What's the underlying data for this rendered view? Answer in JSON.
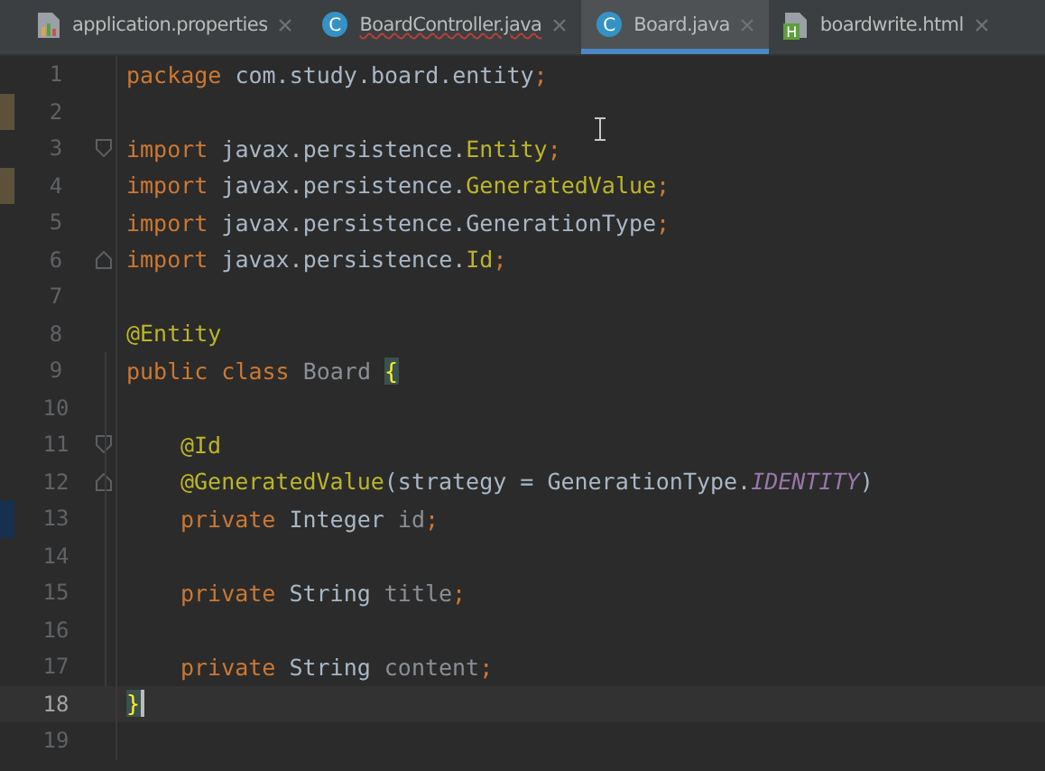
{
  "tabs": [
    {
      "label": "application.properties",
      "kind": "properties",
      "selected": false,
      "error": false
    },
    {
      "label": "BoardController.java",
      "kind": "class",
      "icon_letter": "C",
      "selected": false,
      "error": true
    },
    {
      "label": "Board.java",
      "kind": "class",
      "icon_letter": "C",
      "selected": true,
      "error": false
    },
    {
      "label": "boardwrite.html",
      "kind": "html",
      "icon_letter": "H",
      "selected": false,
      "error": false
    }
  ],
  "lines": [
    {
      "number": "1",
      "current": false,
      "tokens": [
        {
          "text": "package",
          "kind": "keyword"
        },
        {
          "text": " com.study.board.entity",
          "kind": "plain"
        },
        {
          "text": ";",
          "kind": "punct"
        }
      ]
    },
    {
      "number": "2",
      "current": false,
      "color": "#5b5239"
    },
    {
      "number": "3",
      "current": false,
      "fold_open": true,
      "tokens": [
        {
          "text": "import",
          "kind": "keyword"
        },
        {
          "text": " javax.persistence.",
          "kind": "plain"
        },
        {
          "text": "Entity",
          "kind": "used"
        },
        {
          "text": ";",
          "kind": "punct"
        }
      ]
    },
    {
      "number": "4",
      "current": false,
      "color": "#5b5239",
      "tokens": [
        {
          "text": "import",
          "kind": "keyword"
        },
        {
          "text": " javax.persistence.",
          "kind": "plain"
        },
        {
          "text": "GeneratedValue",
          "kind": "used"
        },
        {
          "text": ";",
          "kind": "punct"
        }
      ]
    },
    {
      "number": "5",
      "current": false,
      "tokens": [
        {
          "text": "import",
          "kind": "keyword"
        },
        {
          "text": " javax.persistence.GenerationType",
          "kind": "plain"
        },
        {
          "text": ";",
          "kind": "punct"
        }
      ]
    },
    {
      "number": "6",
      "current": false,
      "fold_close": true,
      "tokens": [
        {
          "text": "import",
          "kind": "keyword"
        },
        {
          "text": " javax.persistence.",
          "kind": "plain"
        },
        {
          "text": "Id",
          "kind": "used"
        },
        {
          "text": ";",
          "kind": "punct"
        }
      ]
    },
    {
      "number": "7",
      "current": false
    },
    {
      "number": "8",
      "current": false,
      "tokens": [
        {
          "text": "@Entity",
          "kind": "annotation"
        }
      ]
    },
    {
      "number": "9",
      "current": false,
      "tokens": [
        {
          "text": "public class ",
          "kind": "keyword"
        },
        {
          "text": "Board ",
          "kind": "field"
        },
        {
          "text": "{",
          "kind": "brace"
        }
      ]
    },
    {
      "number": "10",
      "current": false
    },
    {
      "number": "11",
      "current": false,
      "indented": true,
      "fold_open": true,
      "tokens": [
        {
          "text": "@Id",
          "kind": "annotation"
        }
      ]
    },
    {
      "number": "12",
      "current": false,
      "indented": true,
      "fold_close": true,
      "tokens": [
        {
          "text": "@GeneratedValue",
          "kind": "annotation"
        },
        {
          "text": "(strategy = GenerationType.",
          "kind": "plain"
        },
        {
          "text": "IDENTITY",
          "kind": "constant"
        },
        {
          "text": ")",
          "kind": "plain"
        }
      ]
    },
    {
      "number": "13",
      "current": false,
      "indented": true,
      "color": "#16304d",
      "tokens": [
        {
          "text": "private ",
          "kind": "keyword"
        },
        {
          "text": "Integer ",
          "kind": "plain"
        },
        {
          "text": "id",
          "kind": "field"
        },
        {
          "text": ";",
          "kind": "punct"
        }
      ]
    },
    {
      "number": "14",
      "current": false
    },
    {
      "number": "15",
      "current": false,
      "indented": true,
      "tokens": [
        {
          "text": "private ",
          "kind": "keyword"
        },
        {
          "text": "String ",
          "kind": "plain"
        },
        {
          "text": "title",
          "kind": "field"
        },
        {
          "text": ";",
          "kind": "punct"
        }
      ]
    },
    {
      "number": "16",
      "current": false
    },
    {
      "number": "17",
      "current": false,
      "indented": true,
      "tokens": [
        {
          "text": "private ",
          "kind": "keyword"
        },
        {
          "text": "String ",
          "kind": "plain"
        },
        {
          "text": "content",
          "kind": "field"
        },
        {
          "text": ";",
          "kind": "punct"
        }
      ]
    },
    {
      "number": "18",
      "current": true,
      "tokens": [
        {
          "text": "}",
          "kind": "brace"
        }
      ]
    },
    {
      "number": "19",
      "current": false
    }
  ]
}
